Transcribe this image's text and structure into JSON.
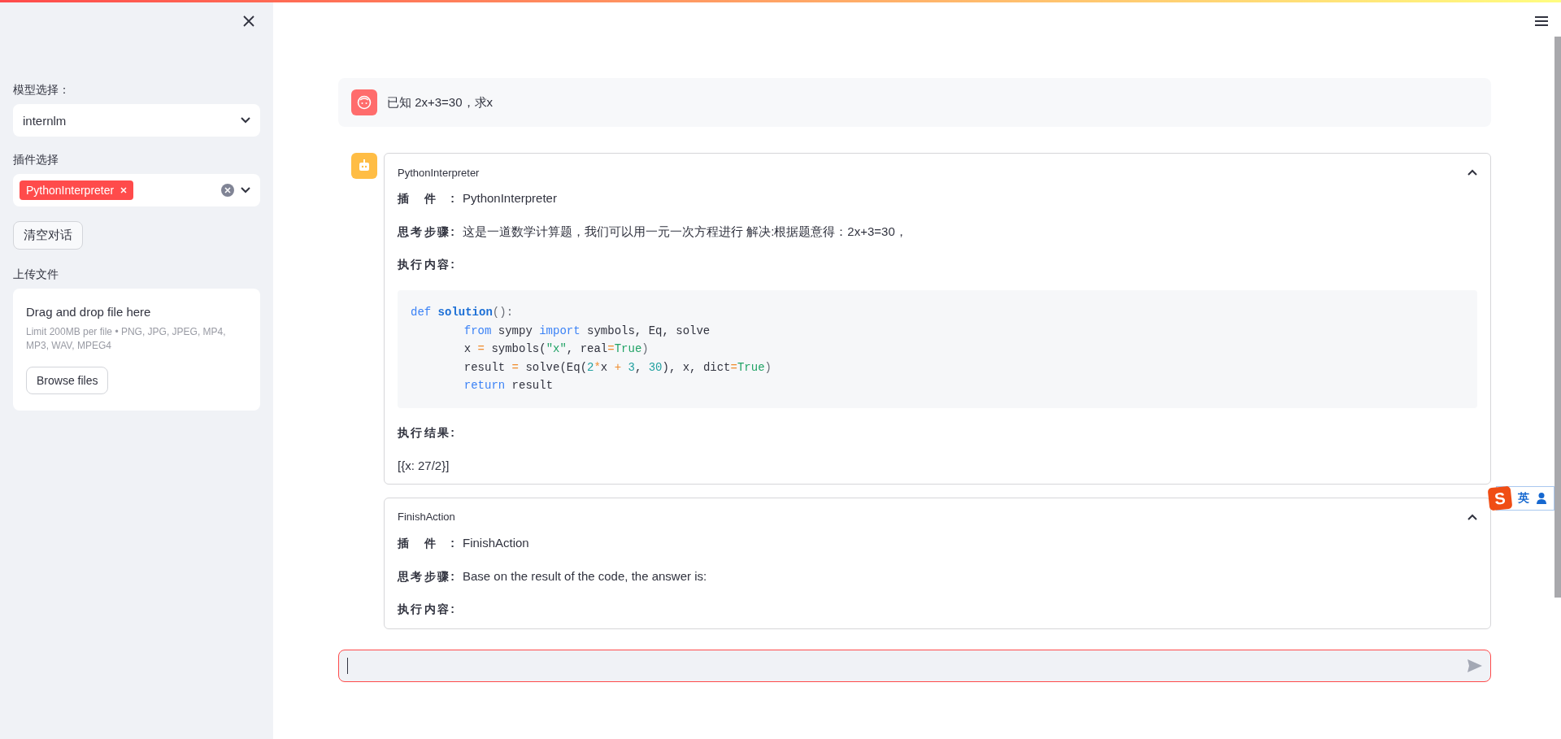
{
  "sidebar": {
    "model_label": "模型选择：",
    "model_select": {
      "value": "internlm"
    },
    "plugin_label": "插件选择",
    "plugin_select": {
      "tags": [
        "PythonInterpreter"
      ]
    },
    "clear_button": "清空对话",
    "upload_label": "上传文件",
    "uploader": {
      "title": "Drag and drop file here",
      "hint": "Limit 200MB per file • PNG, JPG, JPEG, MP4, MP3, WAV, MPEG4",
      "button": "Browse files"
    }
  },
  "messages": [
    {
      "kind": "user",
      "text": "已知 2x+3=30，求x"
    },
    {
      "kind": "assistant",
      "expanders": [
        {
          "title": "PythonInterpreter",
          "expanded": true,
          "items": [
            {
              "kind": "field",
              "label": "插件:",
              "value": "PythonInterpreter"
            },
            {
              "kind": "field",
              "label": "思考步骤:",
              "value": "这是一道数学计算题，我们可以用一元一次方程进行 解决:根据题意得：2x+3=30，"
            },
            {
              "kind": "field",
              "label": "执行内容:"
            },
            {
              "kind": "code",
              "lines": [
                {
                  "indented": false,
                  "tokens": [
                    {
                      "t": "def ",
                      "kind": "keyword"
                    },
                    {
                      "t": "solution",
                      "kind": "function"
                    },
                    {
                      "t": "():",
                      "kind": "punct"
                    }
                  ]
                },
                {
                  "indented": true,
                  "tokens": [
                    {
                      "t": "from",
                      "kind": "keyword"
                    },
                    {
                      "t": " sympy ",
                      "kind": "plain"
                    },
                    {
                      "t": "import",
                      "kind": "keyword"
                    },
                    {
                      "t": " symbols, Eq, solve",
                      "kind": "plain"
                    }
                  ]
                },
                {
                  "indented": true,
                  "tokens": [
                    {
                      "t": "x ",
                      "kind": "plain"
                    },
                    {
                      "t": "=",
                      "kind": "operator"
                    },
                    {
                      "t": " symbols(",
                      "kind": "plain"
                    },
                    {
                      "t": "\"x\"",
                      "kind": "string"
                    },
                    {
                      "t": ", real",
                      "kind": "plain"
                    },
                    {
                      "t": "=",
                      "kind": "operator"
                    },
                    {
                      "t": "True",
                      "kind": "constant"
                    },
                    {
                      "t": ")",
                      "kind": "punct"
                    }
                  ]
                },
                {
                  "indented": true,
                  "tokens": [
                    {
                      "t": "result ",
                      "kind": "plain"
                    },
                    {
                      "t": "=",
                      "kind": "operator"
                    },
                    {
                      "t": " solve(Eq(",
                      "kind": "plain"
                    },
                    {
                      "t": "2",
                      "kind": "number"
                    },
                    {
                      "t": "*",
                      "kind": "operator"
                    },
                    {
                      "t": "x ",
                      "kind": "plain"
                    },
                    {
                      "t": "+ ",
                      "kind": "operator"
                    },
                    {
                      "t": "3",
                      "kind": "number"
                    },
                    {
                      "t": ", ",
                      "kind": "plain"
                    },
                    {
                      "t": "30",
                      "kind": "number"
                    },
                    {
                      "t": "), x, dict",
                      "kind": "plain"
                    },
                    {
                      "t": "=",
                      "kind": "operator"
                    },
                    {
                      "t": "True",
                      "kind": "constant"
                    },
                    {
                      "t": ")",
                      "kind": "punct"
                    }
                  ]
                },
                {
                  "indented": true,
                  "tokens": [
                    {
                      "t": "return",
                      "kind": "keyword"
                    },
                    {
                      "t": " result",
                      "kind": "plain"
                    }
                  ]
                }
              ]
            },
            {
              "kind": "field",
              "label": "执行结果:"
            },
            {
              "kind": "paragraph",
              "text": "[{x: 27/2}]"
            }
          ]
        },
        {
          "title": "FinishAction",
          "expanded": true,
          "items": [
            {
              "kind": "field",
              "label": "插件:",
              "value": "FinishAction"
            },
            {
              "kind": "field",
              "label": "思考步骤:",
              "value": "Base on the result of the code, the answer is:"
            },
            {
              "kind": "field",
              "label": "执行内容:"
            }
          ]
        }
      ]
    }
  ],
  "ime_toolbar": {
    "logo": "S",
    "mode": "英"
  }
}
